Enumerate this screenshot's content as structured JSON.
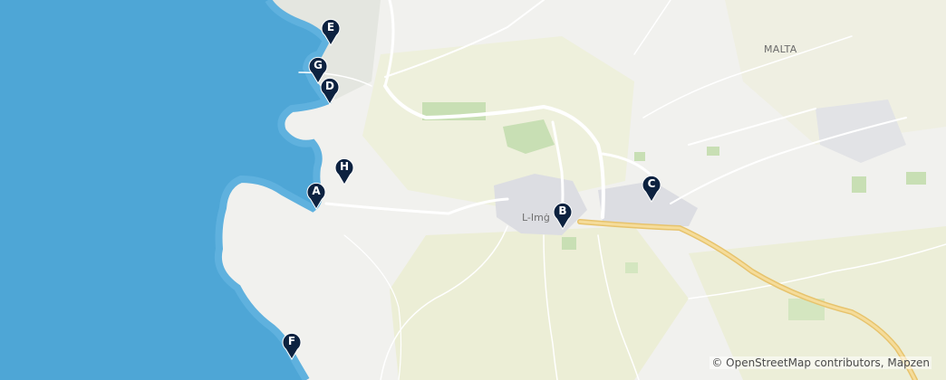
{
  "map": {
    "country_label": "MALTA",
    "town_label": "L-Imġ",
    "attribution": "© OpenStreetMap contributors, Mapzen",
    "colors": {
      "sea": "#4ea6d6",
      "land": "#f1f1ee",
      "urban": "#d9dadf",
      "fields": "#e8ebd4",
      "green": "#c8dfb4",
      "road": "#ffffff",
      "highway": "#f2d48a",
      "marker": "#0d2240"
    },
    "markers": [
      {
        "letter": "A"
      },
      {
        "letter": "B"
      },
      {
        "letter": "C"
      },
      {
        "letter": "D"
      },
      {
        "letter": "E"
      },
      {
        "letter": "F"
      },
      {
        "letter": "G"
      },
      {
        "letter": "H"
      }
    ]
  }
}
